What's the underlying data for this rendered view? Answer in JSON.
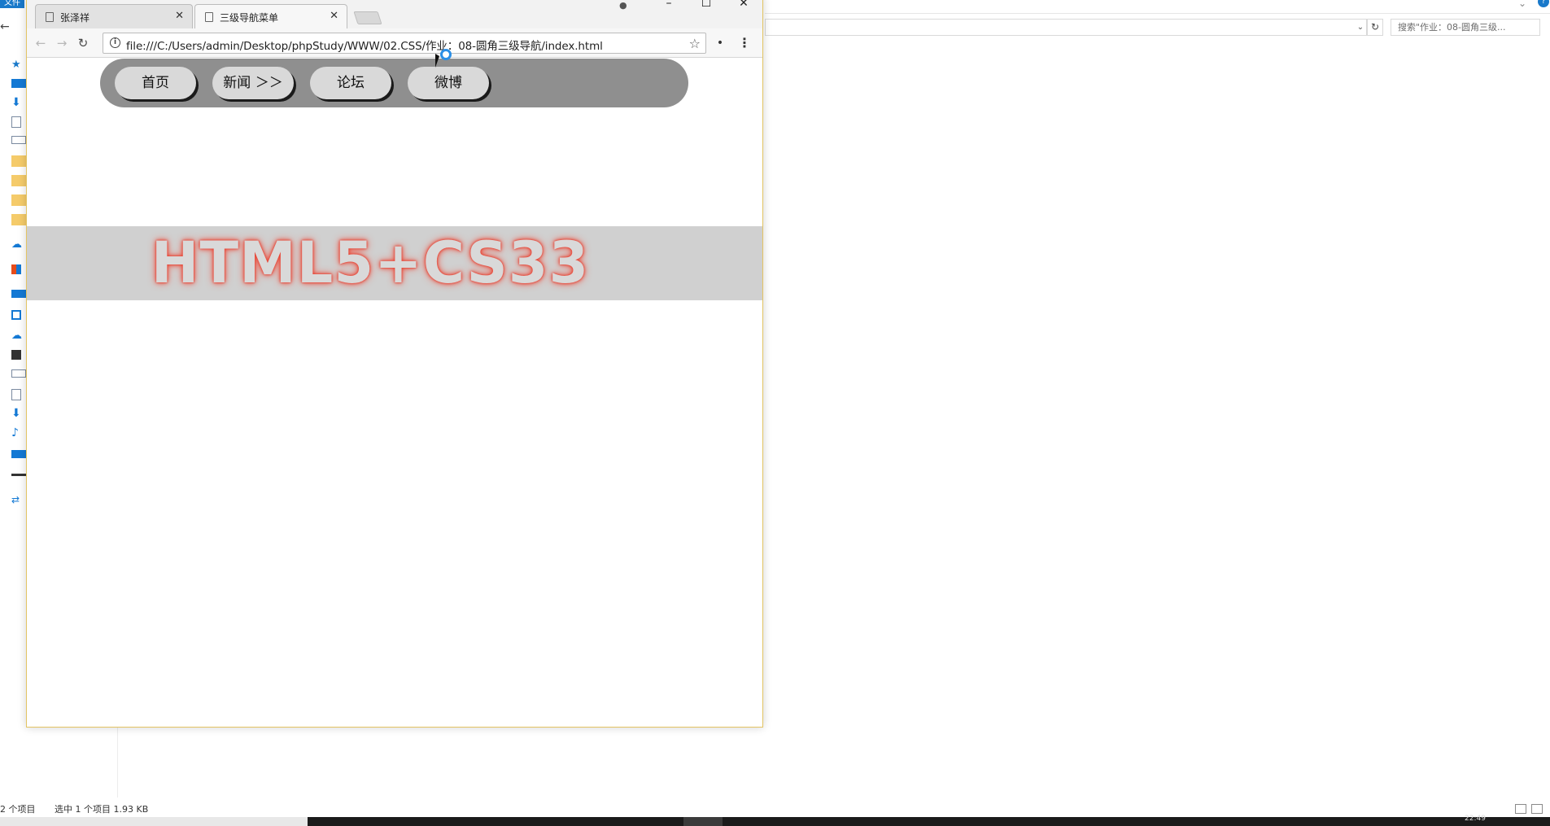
{
  "explorer": {
    "file_tab": "文件",
    "search_placeholder": "搜索\"作业：08-圆角三级...",
    "status_item_count": "2 个项目",
    "status_selection": "选中 1 个项目  1.93 KB",
    "taskbar_clock": "22:49"
  },
  "chrome": {
    "tabs": [
      {
        "title": "张泽祥",
        "active": false
      },
      {
        "title": "三级导航菜单",
        "active": true
      }
    ],
    "url": "file:///C:/Users/admin/Desktop/phpStudy/WWW/02.CSS/作业：08-圆角三级导航/index.html",
    "window_controls": {
      "minimize": "–",
      "maximize": "☐",
      "close": "✕"
    }
  },
  "page": {
    "nav_items": [
      "首页",
      "新闻 ＞＞",
      "论坛",
      "微博"
    ],
    "hero_text": "HTML5+CS33",
    "colors": {
      "navbar_bg": "#8f8f8f",
      "nav_button_bg": "#d9d9d9",
      "hero_band_bg": "#d0d0d0",
      "hero_glow": "#e53a2a"
    }
  }
}
